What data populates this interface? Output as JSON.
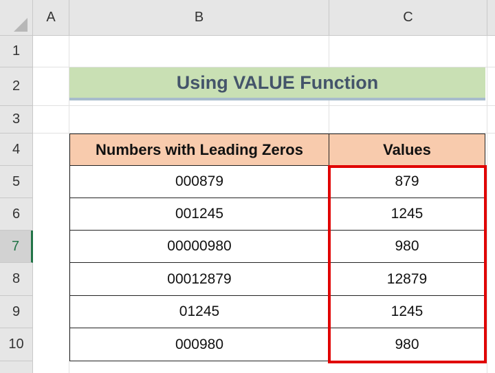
{
  "columns": [
    "A",
    "B",
    "C"
  ],
  "rows": [
    "1",
    "2",
    "3",
    "4",
    "5",
    "6",
    "7",
    "8",
    "9",
    "10"
  ],
  "active_row": "7",
  "title": "Using VALUE Function",
  "table": {
    "headers": [
      "Numbers with Leading Zeros",
      "Values"
    ],
    "rows": [
      [
        "000879",
        "879"
      ],
      [
        "001245",
        "1245"
      ],
      [
        "00000980",
        "980"
      ],
      [
        "00012879",
        "12879"
      ],
      [
        "01245",
        "1245"
      ],
      [
        "000980",
        "980"
      ]
    ]
  },
  "colors": {
    "title_fill": "#c9e0b4",
    "title_text": "#44546a",
    "header_fill": "#f8cbad",
    "highlight": "#e00000",
    "active_header": "#217346"
  }
}
